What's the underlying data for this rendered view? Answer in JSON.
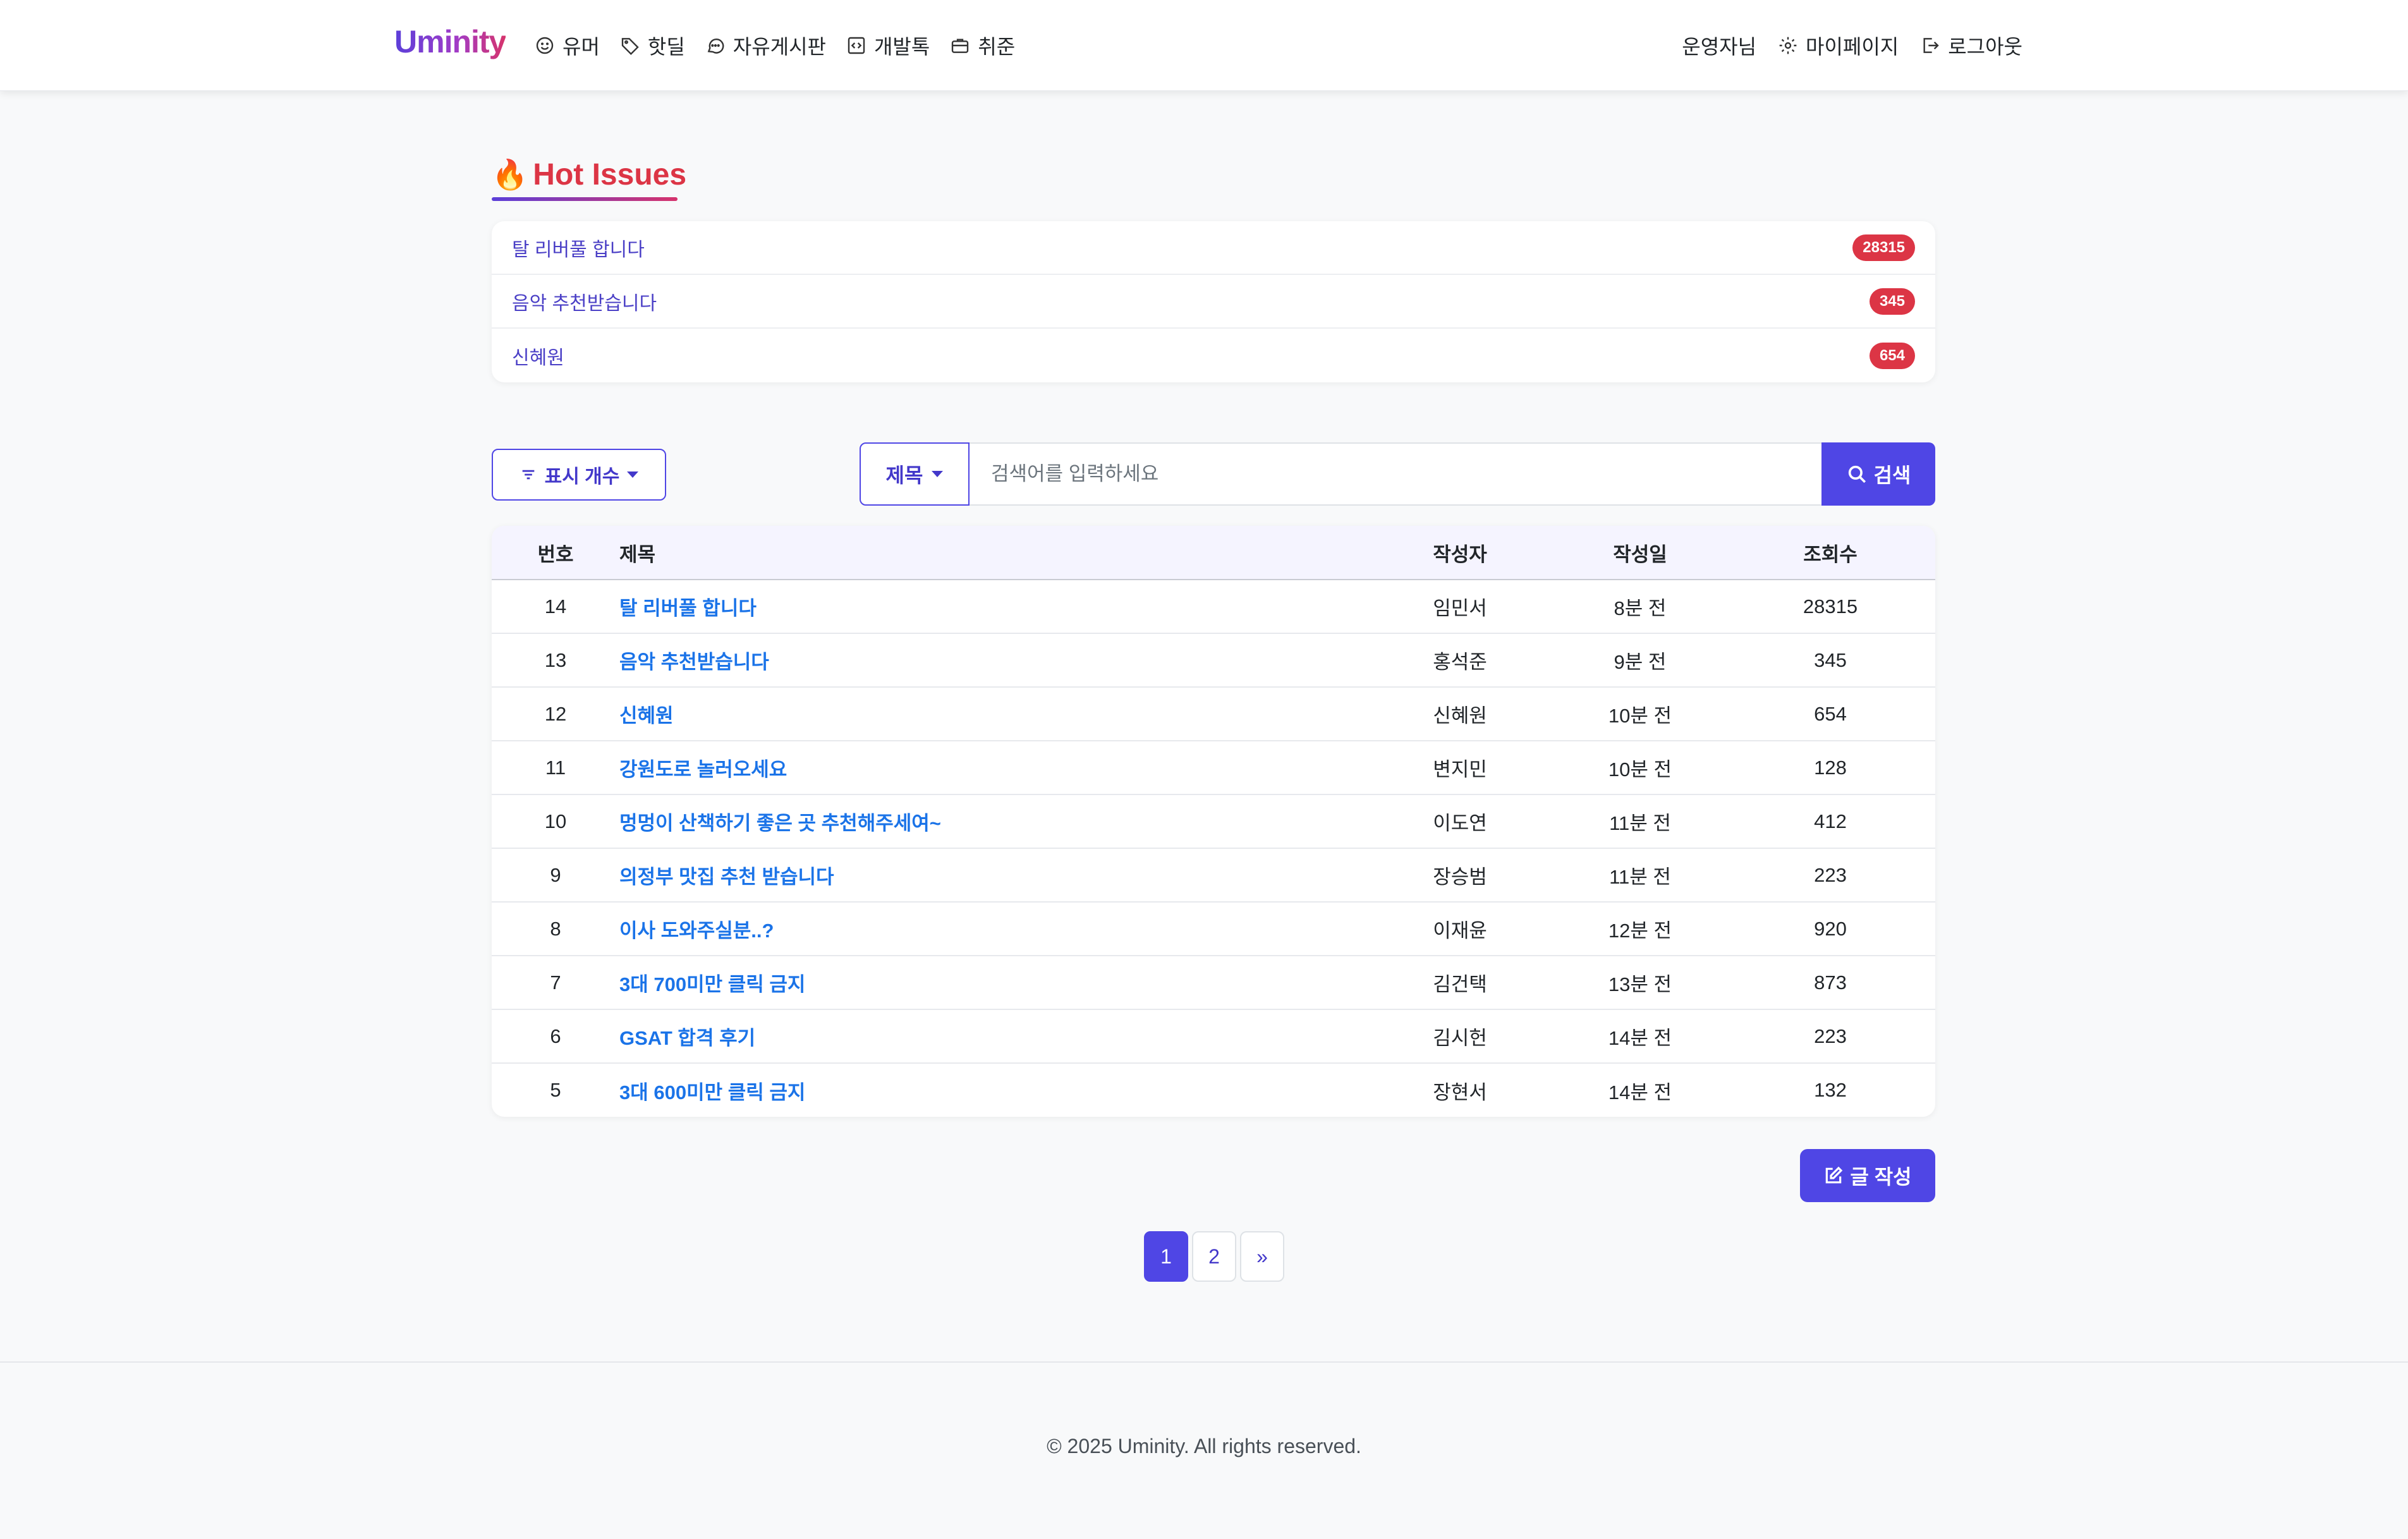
{
  "brand": "Uminity",
  "nav": {
    "left": [
      {
        "label": "유머",
        "icon": "smile-icon"
      },
      {
        "label": "핫딜",
        "icon": "tag-icon"
      },
      {
        "label": "자유게시판",
        "icon": "chat-icon"
      },
      {
        "label": "개발톡",
        "icon": "code-icon"
      },
      {
        "label": "취준",
        "icon": "briefcase-icon"
      }
    ],
    "user": "운영자님",
    "mypage": "마이페이지",
    "logout": "로그아웃"
  },
  "hot_issues": {
    "title": "Hot Issues",
    "items": [
      {
        "title": "탈 리버풀 합니다",
        "count": "28315"
      },
      {
        "title": "음악 추천받습니다",
        "count": "345"
      },
      {
        "title": "신혜원",
        "count": "654"
      }
    ]
  },
  "controls": {
    "count_label": "표시 개수",
    "search_field": "제목",
    "search_placeholder": "검색어를 입력하세요",
    "search_button": "검색"
  },
  "table": {
    "headers": [
      "번호",
      "제목",
      "작성자",
      "작성일",
      "조회수"
    ],
    "rows": [
      {
        "num": "14",
        "title": "탈 리버풀 합니다",
        "author": "임민서",
        "date": "8분 전",
        "views": "28315"
      },
      {
        "num": "13",
        "title": "음악 추천받습니다",
        "author": "홍석준",
        "date": "9분 전",
        "views": "345"
      },
      {
        "num": "12",
        "title": "신혜원",
        "author": "신혜원",
        "date": "10분 전",
        "views": "654"
      },
      {
        "num": "11",
        "title": "강원도로 놀러오세요",
        "author": "변지민",
        "date": "10분 전",
        "views": "128"
      },
      {
        "num": "10",
        "title": "멍멍이 산책하기 좋은 곳 추천해주세여~",
        "author": "이도연",
        "date": "11분 전",
        "views": "412"
      },
      {
        "num": "9",
        "title": "의정부 맛집 추천 받습니다",
        "author": "장승범",
        "date": "11분 전",
        "views": "223"
      },
      {
        "num": "8",
        "title": "이사 도와주실분..?",
        "author": "이재윤",
        "date": "12분 전",
        "views": "920"
      },
      {
        "num": "7",
        "title": "3대 700미만 클릭 금지",
        "author": "김건택",
        "date": "13분 전",
        "views": "873"
      },
      {
        "num": "6",
        "title": "GSAT 합격 후기",
        "author": "김시헌",
        "date": "14분 전",
        "views": "223"
      },
      {
        "num": "5",
        "title": "3대 600미만 클릭 금지",
        "author": "장현서",
        "date": "14분 전",
        "views": "132"
      }
    ]
  },
  "write_button": "글 작성",
  "pagination": {
    "pages": [
      "1",
      "2"
    ],
    "next": "»",
    "current": "1"
  },
  "footer": "© 2025 Uminity. All rights reserved.",
  "colors": {
    "accent": "#4f46e5",
    "hot": "#dc3545",
    "link": "#1a73e8"
  }
}
